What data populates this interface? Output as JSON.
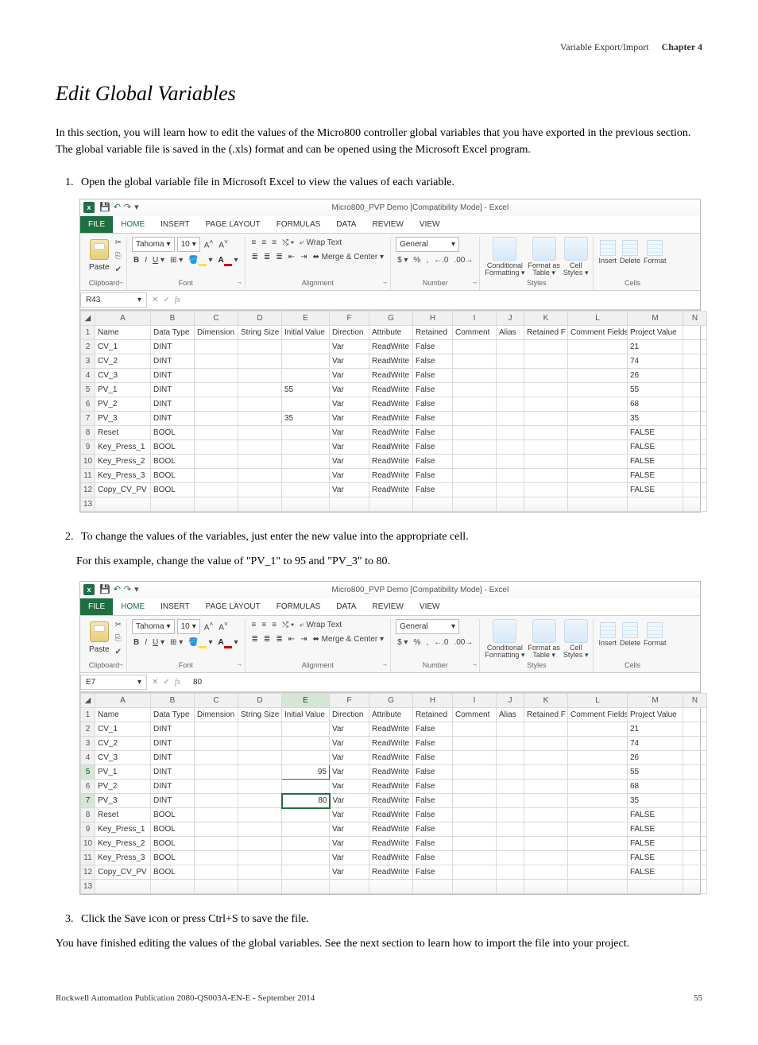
{
  "header": {
    "topic": "Variable Export/Import",
    "chapter": "Chapter 4"
  },
  "section_title": "Edit Global Variables",
  "intro": "In this section, you will learn how to edit the values of the Micro800 controller global variables that you have exported in the previous section. The global variable file is saved in the (.xls) format and can be opened using the Microsoft Excel program.",
  "steps": {
    "s1": "Open the global variable file in Microsoft Excel to view the values of each variable.",
    "s2a": "To change the values of the variables, just enter the new value into the appropriate cell.",
    "s2b": "For this example, change the value of \"PV_1\" to 95 and \"PV_3\" to 80.",
    "s3": "Click the Save icon or press Ctrl+S to save the file."
  },
  "closing": "You have finished editing the values of the global variables. See the next section to learn how to import the file into your project.",
  "excel": {
    "workbook_title": "Micro800_PVP Demo  [Compatibility Mode] - Excel",
    "tabs": {
      "file": "FILE",
      "home": "HOME",
      "insert": "INSERT",
      "page_layout": "PAGE LAYOUT",
      "formulas": "FORMULAS",
      "data": "DATA",
      "review": "REVIEW",
      "view": "VIEW"
    },
    "ribbon": {
      "clipboard": {
        "paste": "Paste",
        "label": "Clipboard"
      },
      "font": {
        "name": "Tahoma",
        "size": "10",
        "label": "Font"
      },
      "alignment": {
        "wrap": "Wrap Text",
        "merge": "Merge & Center",
        "label": "Alignment"
      },
      "number": {
        "format": "General",
        "label": "Number"
      },
      "styles": {
        "cond": "Conditional",
        "cond2": "Formatting",
        "fmt": "Format as",
        "fmt2": "Table",
        "cell": "Cell",
        "cell2": "Styles",
        "label": "Styles"
      },
      "cells": {
        "insert": "Insert",
        "delete": "Delete",
        "format": "Format",
        "label": "Cells"
      }
    },
    "columns": [
      "A",
      "B",
      "C",
      "D",
      "E",
      "F",
      "G",
      "H",
      "I",
      "J",
      "K",
      "L",
      "M",
      "N"
    ],
    "header_row": [
      "Name",
      "Data Type",
      "Dimension",
      "String Size",
      "Initial Value",
      "Direction",
      "Attribute",
      "Retained",
      "Comment",
      "Alias",
      "Retained F",
      "Comment Fields",
      "Project Value",
      ""
    ],
    "data_rows_1": [
      [
        "CV_1",
        "DINT",
        "",
        "",
        "",
        "Var",
        "ReadWrite",
        "False",
        "",
        "",
        "",
        "",
        "21",
        ""
      ],
      [
        "CV_2",
        "DINT",
        "",
        "",
        "",
        "Var",
        "ReadWrite",
        "False",
        "",
        "",
        "",
        "",
        "74",
        ""
      ],
      [
        "CV_3",
        "DINT",
        "",
        "",
        "",
        "Var",
        "ReadWrite",
        "False",
        "",
        "",
        "",
        "",
        "26",
        ""
      ],
      [
        "PV_1",
        "DINT",
        "",
        "",
        "55",
        "Var",
        "ReadWrite",
        "False",
        "",
        "",
        "",
        "",
        "55",
        ""
      ],
      [
        "PV_2",
        "DINT",
        "",
        "",
        "",
        "Var",
        "ReadWrite",
        "False",
        "",
        "",
        "",
        "",
        "68",
        ""
      ],
      [
        "PV_3",
        "DINT",
        "",
        "",
        "35",
        "Var",
        "ReadWrite",
        "False",
        "",
        "",
        "",
        "",
        "35",
        ""
      ],
      [
        "Reset",
        "BOOL",
        "",
        "",
        "",
        "Var",
        "ReadWrite",
        "False",
        "",
        "",
        "",
        "",
        "FALSE",
        ""
      ],
      [
        "Key_Press_1",
        "BOOL",
        "",
        "",
        "",
        "Var",
        "ReadWrite",
        "False",
        "",
        "",
        "",
        "",
        "FALSE",
        ""
      ],
      [
        "Key_Press_2",
        "BOOL",
        "",
        "",
        "",
        "Var",
        "ReadWrite",
        "False",
        "",
        "",
        "",
        "",
        "FALSE",
        ""
      ],
      [
        "Key_Press_3",
        "BOOL",
        "",
        "",
        "",
        "Var",
        "ReadWrite",
        "False",
        "",
        "",
        "",
        "",
        "FALSE",
        ""
      ],
      [
        "Copy_CV_PV",
        "BOOL",
        "",
        "",
        "",
        "Var",
        "ReadWrite",
        "False",
        "",
        "",
        "",
        "",
        "FALSE",
        ""
      ]
    ],
    "data_rows_2": [
      [
        "CV_1",
        "DINT",
        "",
        "",
        "",
        "Var",
        "ReadWrite",
        "False",
        "",
        "",
        "",
        "",
        "21",
        ""
      ],
      [
        "CV_2",
        "DINT",
        "",
        "",
        "",
        "Var",
        "ReadWrite",
        "False",
        "",
        "",
        "",
        "",
        "74",
        ""
      ],
      [
        "CV_3",
        "DINT",
        "",
        "",
        "",
        "Var",
        "ReadWrite",
        "False",
        "",
        "",
        "",
        "",
        "26",
        ""
      ],
      [
        "PV_1",
        "DINT",
        "",
        "",
        "95",
        "Var",
        "ReadWrite",
        "False",
        "",
        "",
        "",
        "",
        "55",
        ""
      ],
      [
        "PV_2",
        "DINT",
        "",
        "",
        "",
        "Var",
        "ReadWrite",
        "False",
        "",
        "",
        "",
        "",
        "68",
        ""
      ],
      [
        "PV_3",
        "DINT",
        "",
        "",
        "80",
        "Var",
        "ReadWrite",
        "False",
        "",
        "",
        "",
        "",
        "35",
        ""
      ],
      [
        "Reset",
        "BOOL",
        "",
        "",
        "",
        "Var",
        "ReadWrite",
        "False",
        "",
        "",
        "",
        "",
        "FALSE",
        ""
      ],
      [
        "Key_Press_1",
        "BOOL",
        "",
        "",
        "",
        "Var",
        "ReadWrite",
        "False",
        "",
        "",
        "",
        "",
        "FALSE",
        ""
      ],
      [
        "Key_Press_2",
        "BOOL",
        "",
        "",
        "",
        "Var",
        "ReadWrite",
        "False",
        "",
        "",
        "",
        "",
        "FALSE",
        ""
      ],
      [
        "Key_Press_3",
        "BOOL",
        "",
        "",
        "",
        "Var",
        "ReadWrite",
        "False",
        "",
        "",
        "",
        "",
        "FALSE",
        ""
      ],
      [
        "Copy_CV_PV",
        "BOOL",
        "",
        "",
        "",
        "Var",
        "ReadWrite",
        "False",
        "",
        "",
        "",
        "",
        "FALSE",
        ""
      ]
    ],
    "namebox_1": "R43",
    "namebox_2": "E7",
    "fx_value_2": "80"
  },
  "footer": {
    "pub": "Rockwell Automation Publication 2080-QS003A-EN-E - September 2014",
    "page": "55"
  }
}
